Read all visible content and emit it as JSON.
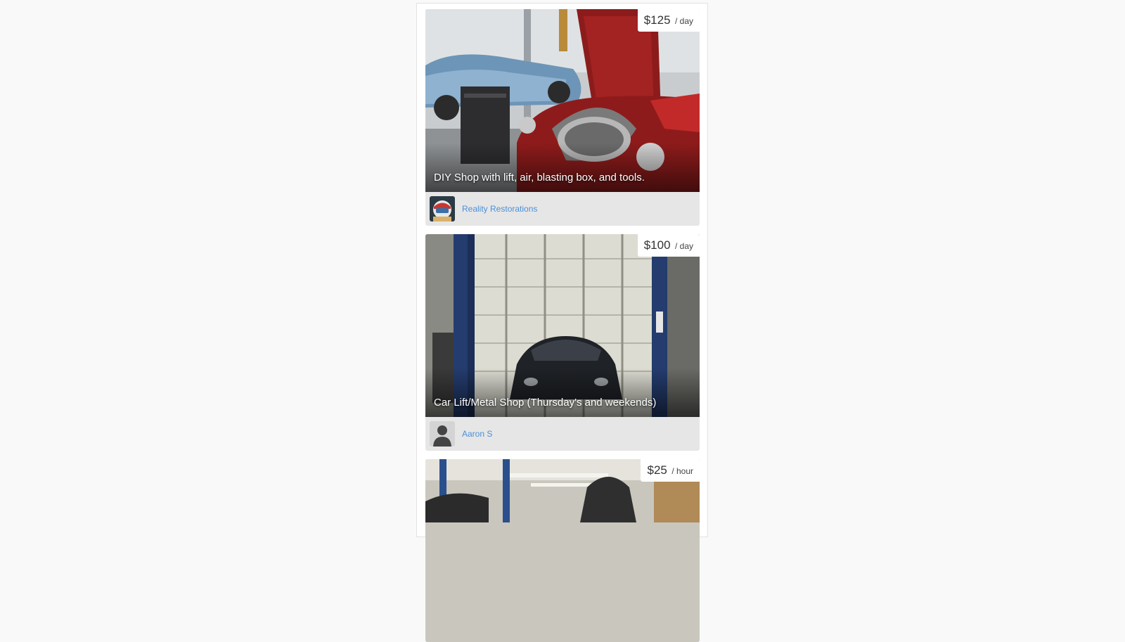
{
  "listings": [
    {
      "price": "$125",
      "unit": "/ day",
      "title": "DIY Shop with lift, air, blasting box, and tools.",
      "owner": "Reality Restorations",
      "photo_icon": "classic-cars-garage-photo",
      "avatar_icon": "racing-helmet-avatar"
    },
    {
      "price": "$100",
      "unit": "/ day",
      "title": "Car Lift/Metal Shop (Thursday's and weekends)",
      "owner": "Aaron S",
      "photo_icon": "car-on-lift-photo",
      "avatar_icon": "default-user-avatar"
    },
    {
      "price": "$25",
      "unit": "/ hour",
      "title": "",
      "owner": "",
      "photo_icon": "auto-shop-photo"
    }
  ],
  "colors": {
    "page_bg": "#f9f9f9",
    "card_footer_bg": "#e6e6e6",
    "owner_link": "#4a90d9",
    "price_bg": "#ffffff"
  }
}
